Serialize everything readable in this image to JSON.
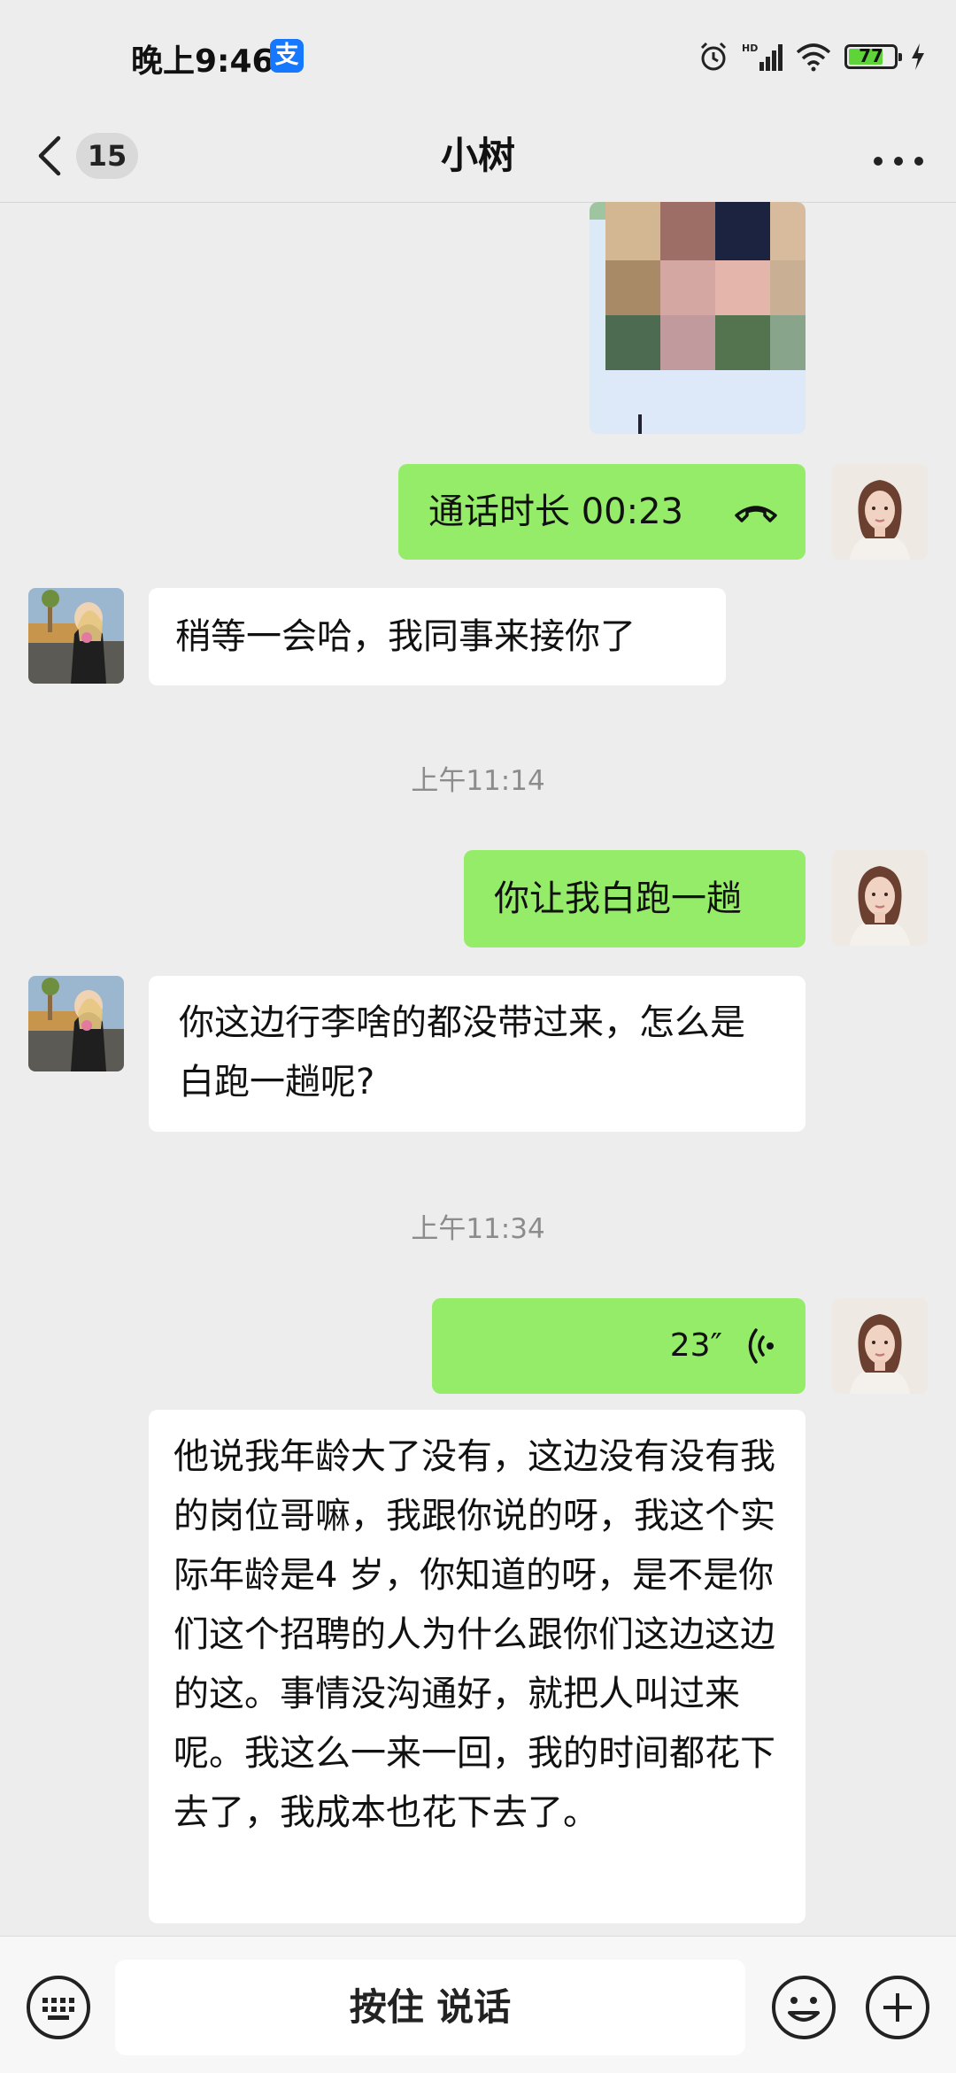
{
  "status_bar": {
    "time": "晚上9:46",
    "alipay_icon": "支",
    "battery": "77",
    "battery_level": 0.77
  },
  "header": {
    "unread_count": "15",
    "title": "小树"
  },
  "messages": {
    "call": "通话时长 00:23",
    "m1": "稍等一会哈，我同事来接你了",
    "t1": "上午11:14",
    "m2": "你让我白跑一趟",
    "m3": "你这边行李啥的都没带过来，怎么是白跑一趟呢?",
    "t2": "上午11:34",
    "voice": "23″",
    "m4": "他说我年龄大了没有，这边没有没有我的岗位哥嘛，我跟你说的呀，我这个实际年龄是4 岁，你知道的呀，是不是你们这个招聘的人为什么跟你们这边这边的这。事情没沟通好，就把人叫过来呢。我这么一来一回，我的时间都花下去了，我成本也花下去了。"
  },
  "input_bar": {
    "hold_to_talk": "按住 说话"
  },
  "icons": {
    "back": "back-arrow-icon",
    "more": "more-dots-icon",
    "call": "phone-hangup-icon",
    "voice": "voice-wave-icon",
    "keyboard": "keyboard-icon",
    "emoji": "emoji-icon",
    "plus": "plus-icon"
  },
  "colors": {
    "green_bubble": "#95ec69",
    "white_bubble": "#ffffff",
    "background": "#ededed"
  }
}
